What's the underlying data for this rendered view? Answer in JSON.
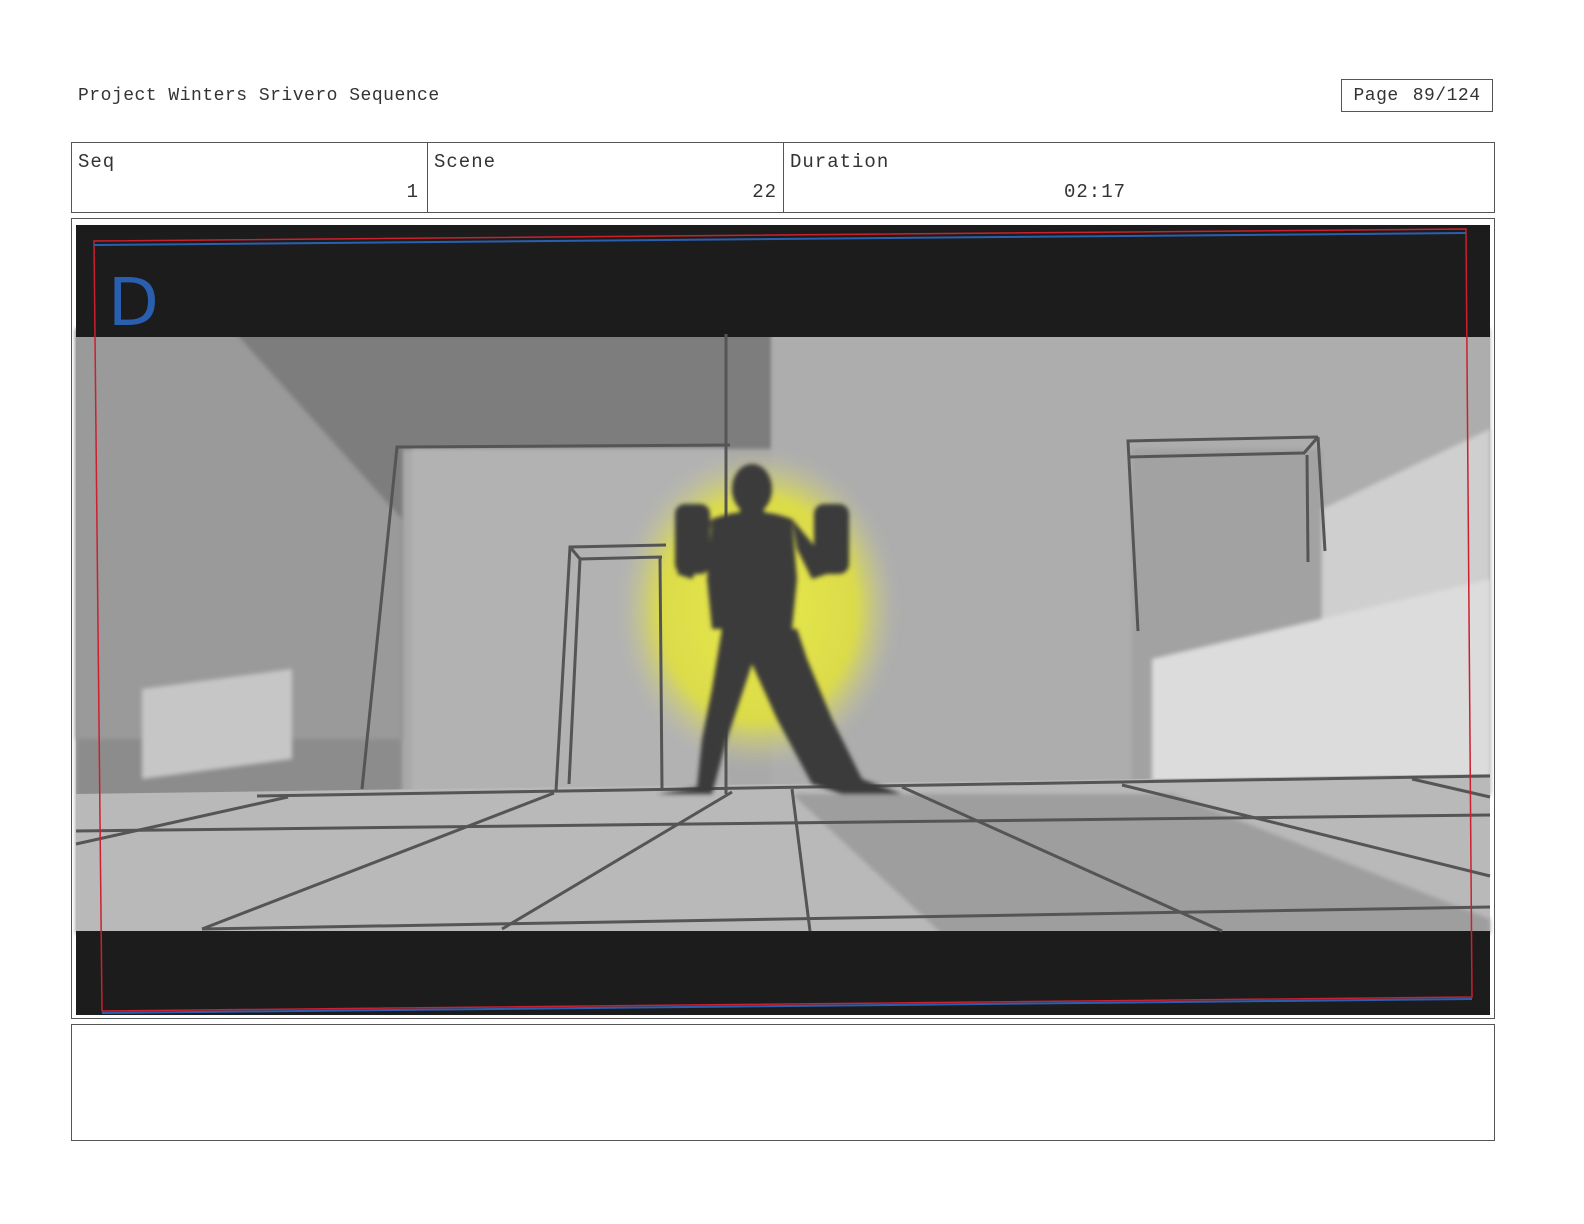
{
  "header": {
    "project_title": "Project Winters Srivero Sequence",
    "page_label": "Page",
    "page_number": "89/124"
  },
  "info": {
    "seq_label": "Seq",
    "seq_value": "1",
    "scene_label": "Scene",
    "scene_value": "22",
    "duration_label": "Duration",
    "duration_value": "02:17"
  },
  "panel": {
    "letter": "D",
    "letter_color": "#2a5fb0",
    "glow_color": "#e8e84a",
    "safe_frame_colors": [
      "#cc1f2f",
      "#2a5fb0"
    ]
  },
  "notes": {
    "text": ""
  }
}
